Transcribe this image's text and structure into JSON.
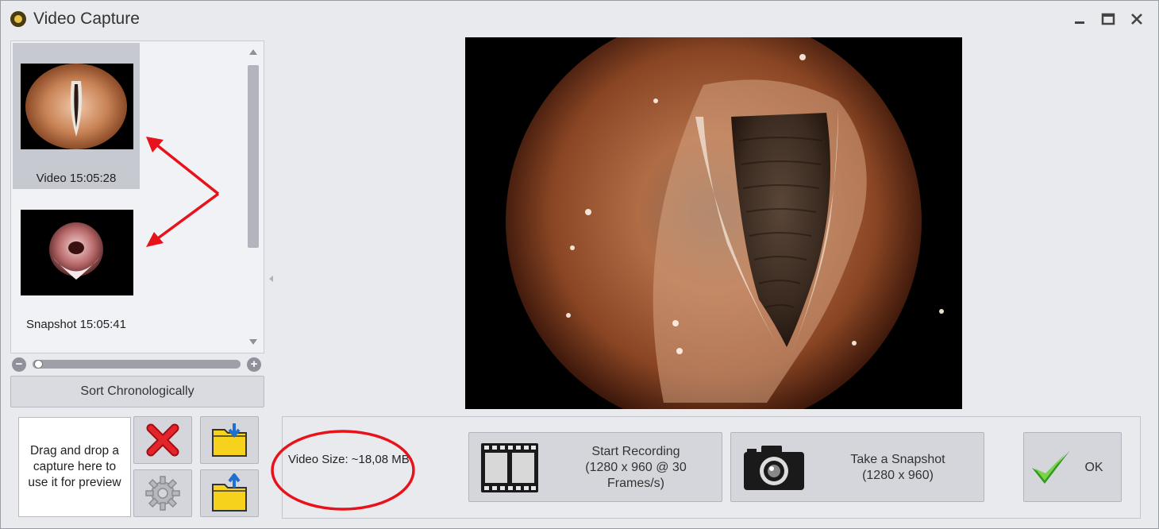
{
  "window": {
    "title": "Video Capture",
    "controls": [
      "minimize",
      "maximize",
      "close"
    ]
  },
  "captures": [
    {
      "label": "Video 15:05:28",
      "type": "video",
      "selected": true
    },
    {
      "label": "Snapshot 15:05:41",
      "type": "snapshot",
      "selected": false
    }
  ],
  "sort_button": {
    "label": "Sort Chronologically"
  },
  "zoom": {
    "minus": "−",
    "plus": "+",
    "level": 0.02
  },
  "drop_zone": {
    "text": "Drag and drop a capture here to use it for preview"
  },
  "tools": {
    "delete_icon": "red-x-icon",
    "settings_icon": "gear-icon",
    "import_icon": "folder-down-icon",
    "export_icon": "folder-up-icon"
  },
  "video_size": {
    "text": "Video Size: ~18,08 MB"
  },
  "record_button": {
    "line1": "Start Recording",
    "line2": "(1280 x 960 @ 30",
    "line3": "Frames/s)",
    "icon": "film-strip-icon"
  },
  "snapshot_button": {
    "line1": "Take a Snapshot",
    "line2": "(1280 x 960)",
    "icon": "camera-icon"
  },
  "ok_button": {
    "label": "OK",
    "icon": "green-check-icon"
  },
  "colors": {
    "annotation": "#e8131a",
    "background": "#e9eaee",
    "button": "#d4d6dc"
  }
}
